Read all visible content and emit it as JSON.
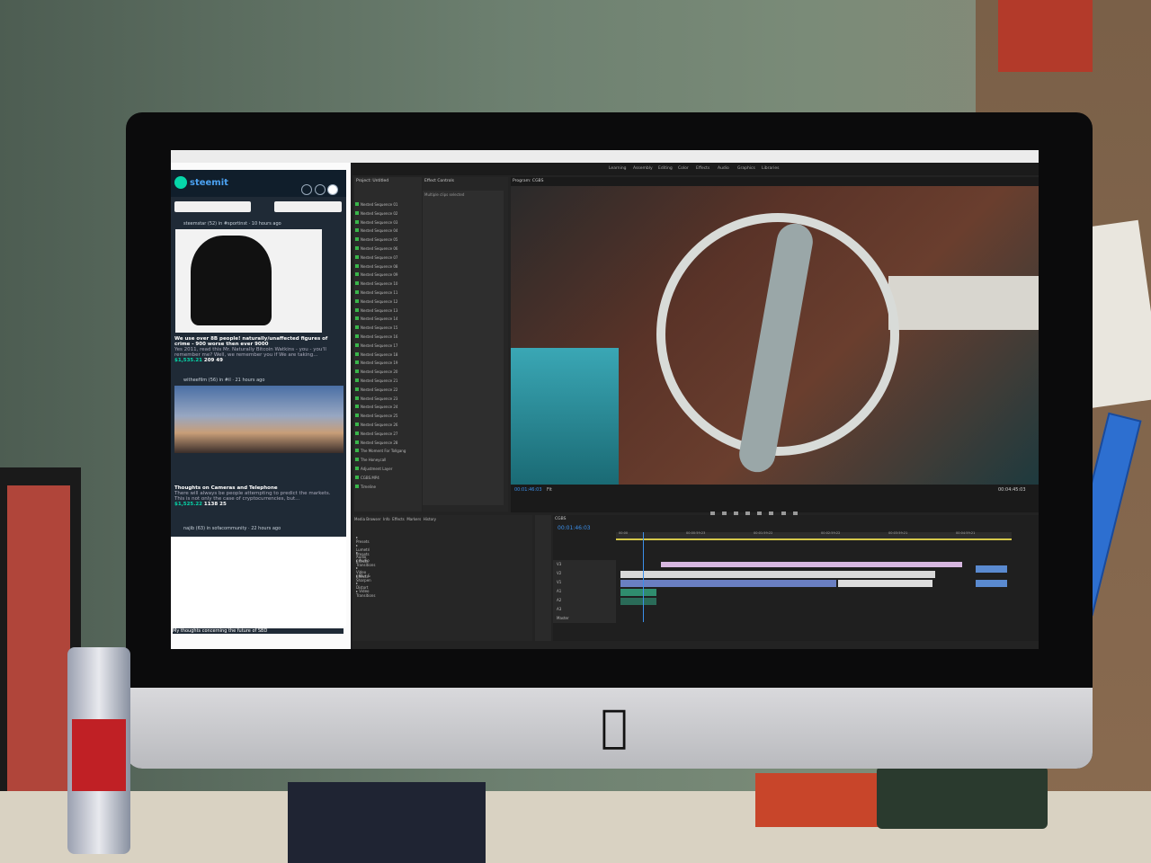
{
  "scene": {
    "wall_color": "#6d8070",
    "monitor_bezel_color": "#0b0b0c",
    "monitor_chin_color": "#c9cacd",
    "logo_icon": "apple-logo-icon"
  },
  "browser": {
    "site_logo_text": "steemit",
    "posts": [
      {
        "meta": "steemstar (52) in #sportinst · 10 hours ago",
        "title": "We use over 8B people! naturally/unaffected figures of crime - 900 worse then ever 9000",
        "excerpt": "Yes 2011, read this Mr. Naturally Bitcoin Watkins - you - you'll remember me? Well, we remember you if We are taking...",
        "payout": "$1,535.21",
        "votes": "209",
        "comments": "49"
      },
      {
        "meta": "witheefilm (56) in #il · 21 hours ago",
        "title": "Thoughts on Cameras and Telephone",
        "excerpt": "There will always be people attempting to predict the markets. This is not only the case of cryptocurrencies, but...",
        "payout": "$1,525.22",
        "votes": "1138",
        "comments": "25"
      }
    ],
    "next_post_meta": "najib (63) in sofacommunity · 22 hours ago",
    "footer_title": "My thoughts concerning the future of SBD"
  },
  "premiere": {
    "workspace_tabs": [
      "Learning",
      "Assembly",
      "Editing",
      "Color",
      "Effects",
      "Audio",
      "Graphics",
      "Libraries"
    ],
    "project_panel_title": "Project: Untitled",
    "effect_controls_tab": "Effect Controls",
    "audio_clip_mixer_tab": "Audio",
    "program_tab": "Program: CGBS",
    "source_note": "Multiple clips selected",
    "timeline_tabs": [
      "Media Browser",
      "Info",
      "Effects",
      "Markers",
      "History"
    ],
    "project_items": [
      "Nested Sequence 01",
      "Nested Sequence 02",
      "Nested Sequence 03",
      "Nested Sequence 04",
      "Nested Sequence 05",
      "Nested Sequence 06",
      "Nested Sequence 07",
      "Nested Sequence 08",
      "Nested Sequence 09",
      "Nested Sequence 10",
      "Nested Sequence 11",
      "Nested Sequence 12",
      "Nested Sequence 13",
      "Nested Sequence 14",
      "Nested Sequence 15",
      "Nested Sequence 16",
      "Nested Sequence 17",
      "Nested Sequence 18",
      "Nested Sequence 19",
      "Nested Sequence 20",
      "Nested Sequence 21",
      "Nested Sequence 22",
      "Nested Sequence 23",
      "Nested Sequence 24",
      "Nested Sequence 25",
      "Nested Sequence 26",
      "Nested Sequence 27",
      "Nested Sequence 28",
      "The Moment For Tollgang",
      "The Honeycall",
      "Adjustment Layer",
      "CGBS.MP4",
      "Timeline"
    ],
    "effects_tree": [
      "Presets",
      "Lumetri Presets",
      "Audio Effects",
      "Audio Transitions",
      "Video Effects",
      "Blur & Sharpen",
      "Distort",
      "Video Transitions"
    ],
    "program_timecode": "00:01:46:03",
    "fit_label": "Fit",
    "timeline_timecode": "00:01:46:03",
    "timeline_name": "CGBS",
    "ruler_labels": [
      "00:00",
      "00:00:59:23",
      "00:01:59:22",
      "00:02:59:22",
      "00:03:59:21",
      "00:04:59:21"
    ],
    "track_labels": [
      "V3",
      "V2",
      "V1",
      "A1",
      "A2",
      "A3",
      "Master"
    ],
    "duration": "00:04:45:03"
  }
}
